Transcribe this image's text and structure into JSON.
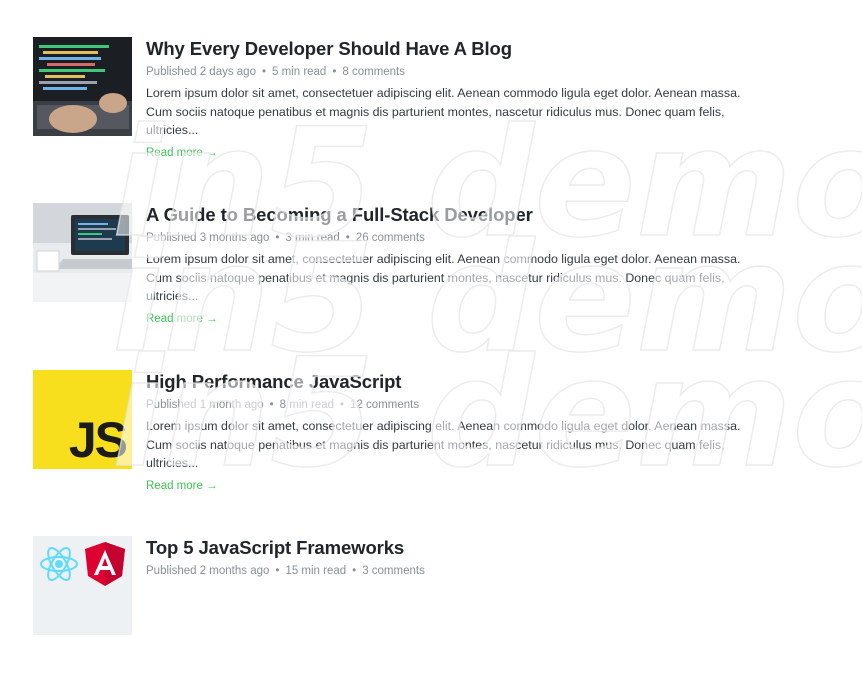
{
  "posts": [
    {
      "title": "Why Every Developer Should Have A Blog",
      "published": "Published 2 days ago",
      "read_time": "5 min read",
      "comments": "8 comments",
      "excerpt": "Lorem ipsum dolor sit amet, consectetuer adipiscing elit. Aenean commodo ligula eget dolor. Aenean massa. Cum sociis natoque penatibus et magnis dis parturient montes, nascetur ridiculus mus. Donec quam felis, ultricies...",
      "read_more": "Read more →"
    },
    {
      "title": "A Guide to Becoming a Full-Stack Developer",
      "published": "Published 3 months ago",
      "read_time": "3 min read",
      "comments": "26 comments",
      "excerpt": "Lorem ipsum dolor sit amet, consectetuer adipiscing elit. Aenean commodo ligula eget dolor. Aenean massa. Cum sociis natoque penatibus et magnis dis parturient montes, nascetur ridiculus mus. Donec quam felis, ultricies...",
      "read_more": "Read more →"
    },
    {
      "title": "High Performance JavaScript",
      "published": "Published 1 month ago",
      "read_time": "8 min read",
      "comments": "12 comments",
      "excerpt": "Lorem ipsum dolor sit amet, consectetuer adipiscing elit. Aenean commodo ligula eget dolor. Aenean massa. Cum sociis natoque penatibus et magnis dis parturient montes, nascetur ridiculus mus. Donec quam felis, ultricies...",
      "read_more": "Read more →",
      "thumb_text": "JS"
    },
    {
      "title": "Top 5 JavaScript Frameworks",
      "published": "Published 2 months ago",
      "read_time": "15 min read",
      "comments": "3 comments"
    }
  ],
  "watermark": "in5 demo",
  "colors": {
    "accent": "#40c057",
    "js_yellow": "#f7df1e",
    "react_blue": "#61dafb",
    "angular_red": "#dd0031"
  }
}
